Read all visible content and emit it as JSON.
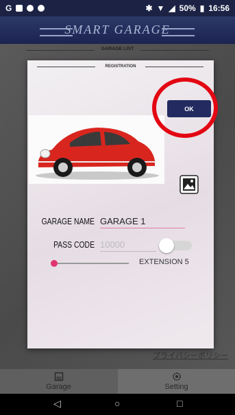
{
  "status_bar": {
    "left_letter": "G",
    "battery": "50%",
    "time": "16:56"
  },
  "app": {
    "brand": "SMART GARAGE"
  },
  "page": {
    "section_title": "GARAGE LIST",
    "privacy_link": "プライバシーポリシー"
  },
  "dialog": {
    "title": "REGISTRATION",
    "ok_label": "OK",
    "garage_name_label": "GARAGE NAME",
    "garage_name_value": "GARAGE 1",
    "pass_code_label": "PASS CODE",
    "pass_code_placeholder": "10000",
    "pass_code_toggle_on": false,
    "extension_label": "EXTENSION 5",
    "extension_slider_fraction": 0.0
  },
  "tabs": [
    {
      "label": "Garage",
      "icon": "garage-icon"
    },
    {
      "label": "Setting",
      "icon": "gear-icon"
    }
  ],
  "colors": {
    "header": "#1c2244",
    "ok_button": "#222a60",
    "accent": "#e0356f",
    "highlight_ring": "#e30613"
  }
}
